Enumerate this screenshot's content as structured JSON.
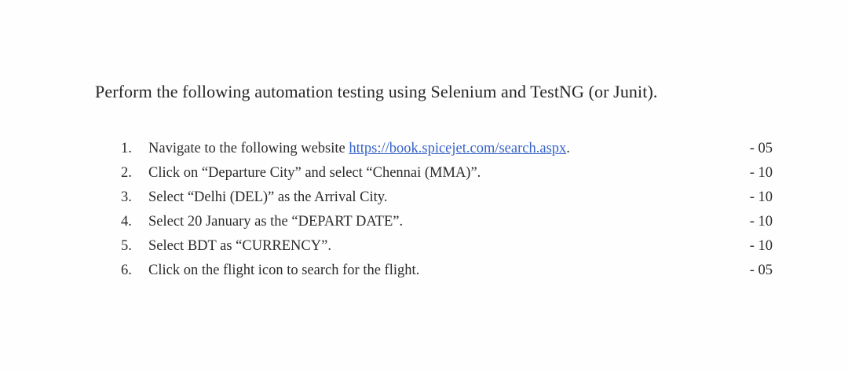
{
  "heading": "Perform the following automation testing using Selenium and TestNG (or Junit).",
  "tasks": [
    {
      "num": "1.",
      "text": "Navigate to the following website ",
      "link": "https://book.spicejet.com/search.aspx",
      "after": ".",
      "marks": "- 05"
    },
    {
      "num": "2.",
      "text": "Click on “Departure City” and select “Chennai (MMA)”.",
      "marks": "- 10"
    },
    {
      "num": "3.",
      "text": "Select “Delhi (DEL)” as the Arrival City.",
      "marks": "- 10"
    },
    {
      "num": "4.",
      "text": "Select 20 January as the “DEPART DATE”.",
      "marks": "- 10"
    },
    {
      "num": "5.",
      "text": "Select BDT as “CURRENCY”.",
      "marks": "- 10"
    },
    {
      "num": "6.",
      "text": "Click on the flight icon to search for the flight.",
      "marks": "- 05"
    }
  ]
}
